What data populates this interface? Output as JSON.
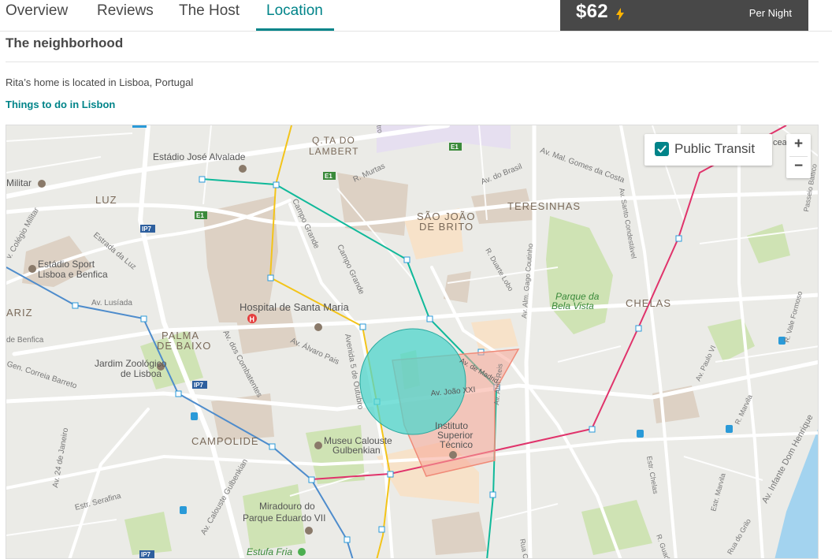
{
  "nav": {
    "tabs": [
      {
        "label": "Overview"
      },
      {
        "label": "Reviews"
      },
      {
        "label": "The Host"
      },
      {
        "label": "Location"
      }
    ],
    "active_tab": "Location"
  },
  "booking": {
    "price": "$62",
    "price_unit": "Per Night",
    "price_icon": "lightning-bolt-icon",
    "bolt_color": "#ffb400"
  },
  "section": {
    "title": "The neighborhood",
    "description": "Rita’s home is located in Lisboa, Portugal",
    "link_label": "Things to do in Lisbon"
  },
  "map": {
    "transit_toggle_label": "Public Transit",
    "transit_checked": true,
    "zoom_in_label": "+",
    "zoom_out_label": "−",
    "colors": {
      "accent": "#008489",
      "metro_green": "#10b99a",
      "metro_yellow": "#f3c419",
      "metro_blue": "#4e8ccc",
      "metro_red": "#e0336b",
      "area_circle": "#4fd6cc",
      "area_polygon": "#f7a696"
    },
    "labels": {
      "qta_do_lambert_1": "Q.TA DO",
      "qta_do_lambert_2": "LAMBERT",
      "estadio_alvalade": "Estádio José Alvalade",
      "militar": "Militar",
      "luz": "LUZ",
      "colegio_militar": "v. Colégio Militar",
      "estrada_luz": "Estrada da Luz",
      "estadio_sport_1": "Estádio Sport",
      "estadio_sport_2": "Lisboa e Benfica",
      "av_lusiada": "Av. Lusíada",
      "ariz": "ARIZ",
      "de_benfica": "de Benfica",
      "palma_1": "PALMA",
      "palma_2": "DE BAIXO",
      "jardim_1": "Jardim Zoológico",
      "jardim_2": "de Lisboa",
      "correia_barreto": "Gen. Correia Barreto",
      "campolide": "CAMPOLIDE",
      "av_24_janeiro": "Av. 24 de Janeiro",
      "estr_serafina": "Estr. Serafina",
      "calouste_gulbenkian": "Av. Calouste Gulbenkian",
      "miradouro_1": "Miradouro do",
      "miradouro_2": "Parque Eduardo VII",
      "estufa_fria": "Estufa Fria",
      "hospital": "Hospital de Santa Maria",
      "av_alvaro_pais": "Av. Álvaro Pais",
      "av_combatentes": "Av. dos Combatentes",
      "museu_1": "Museu Calouste",
      "museu_2": "Gulbenkian",
      "campo_grande_1": "Campo Grande",
      "campo_grande_2": "Campo Grande",
      "av_5_outubro": "Avenida 5 de Outubro",
      "r_murtas": "R. Murtas",
      "sao_joao_1": "SÃO JOÃO",
      "sao_joao_2": "DE BRITO",
      "av_do_brasil": "Av. do Brasil",
      "av_gomes_costa": "Av. Mal. Gomes da Costa",
      "teresinhas": "TERESINHAS",
      "r_duarte_lobo": "R. Duarte Lobo",
      "av_gago_coutinho": "Av. Alm. Gago Coutinho",
      "parque_bela_vista_1": "Parque da",
      "parque_bela_vista_2": "Bela Vista",
      "av_santo_condestavel": "Av. Santo Condestável",
      "chelas": "CHELAS",
      "av_paulo_vi": "Av. Paulo VI",
      "r_vale_formoso": "R. Vale Formoso",
      "passeio_baltico": "Passeio Báltico",
      "av_marvila": "R. Marvila",
      "av_infante": "Av. Infante Dom Henrique",
      "estr_marvila": "Estr. Marvila",
      "estr_chelas": "Estr. Chelas",
      "rua_do_grilo": "Rua do Grilo",
      "av_de_madrid": "Av. de Madrid",
      "av_joao_xxi": "Av. João XXI",
      "instituto_1": "Instituto",
      "instituto_2": "Superior",
      "instituto_3": "Técnico",
      "av_alm_reis": "Av. Alm. Reis",
      "r_guadiana": "R. Guadiana",
      "rua_ca": "Rua Ca",
      "r_tro": "tro",
      "ceado": "ceado",
      "e1_a": "E1",
      "e1_b": "E1",
      "e1_c": "E1",
      "ip7_a": "IP7",
      "ip7_b": "IP7",
      "ip7_c": "IP7",
      "h_marker": "H"
    }
  }
}
